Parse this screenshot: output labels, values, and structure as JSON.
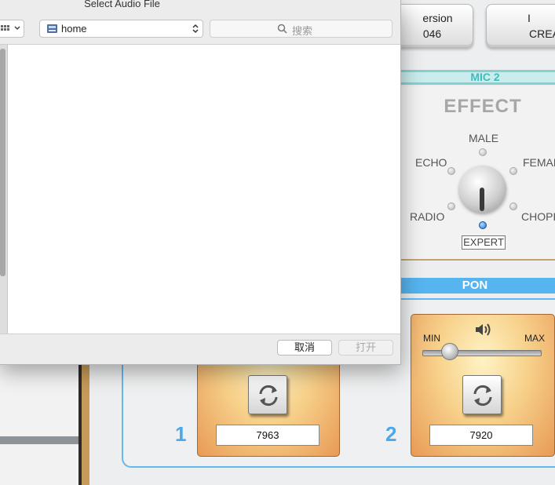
{
  "app": {
    "top_buttons": [
      {
        "line1": "ersion",
        "line2": "046"
      },
      {
        "line1": "I",
        "line2": "CREA"
      }
    ],
    "mic_header": "MIC 2",
    "effect": {
      "title": "EFFECT",
      "labels": {
        "male": "MALE",
        "echo": "ECHO",
        "female": "FEMAL",
        "radio": "RADIO",
        "chopper": "CHOPP",
        "expert": "EXPERT"
      },
      "selected": "expert"
    },
    "pon_header": "PON",
    "volume": {
      "min_label": "MIN",
      "max_label": "MAX",
      "level": 0.2
    },
    "slots": [
      {
        "number": "1",
        "value": "7963"
      },
      {
        "number": "2",
        "value": "7920"
      }
    ]
  },
  "dialog": {
    "title": "Select Audio File",
    "location": "home",
    "search_placeholder": "搜索",
    "cancel_label": "取消",
    "open_label": "打开"
  },
  "icons": {
    "view": "grid-view-icon",
    "disk": "home-disk-icon",
    "search": "magnifier-icon",
    "speaker": "speaker-icon",
    "refresh": "refresh-arrows-icon"
  },
  "colors": {
    "accent_blue": "#56b4ef",
    "mic_teal": "#3fbcbc",
    "slot_orange": "#e89a55",
    "selected_dot": "#1f6fd8"
  }
}
